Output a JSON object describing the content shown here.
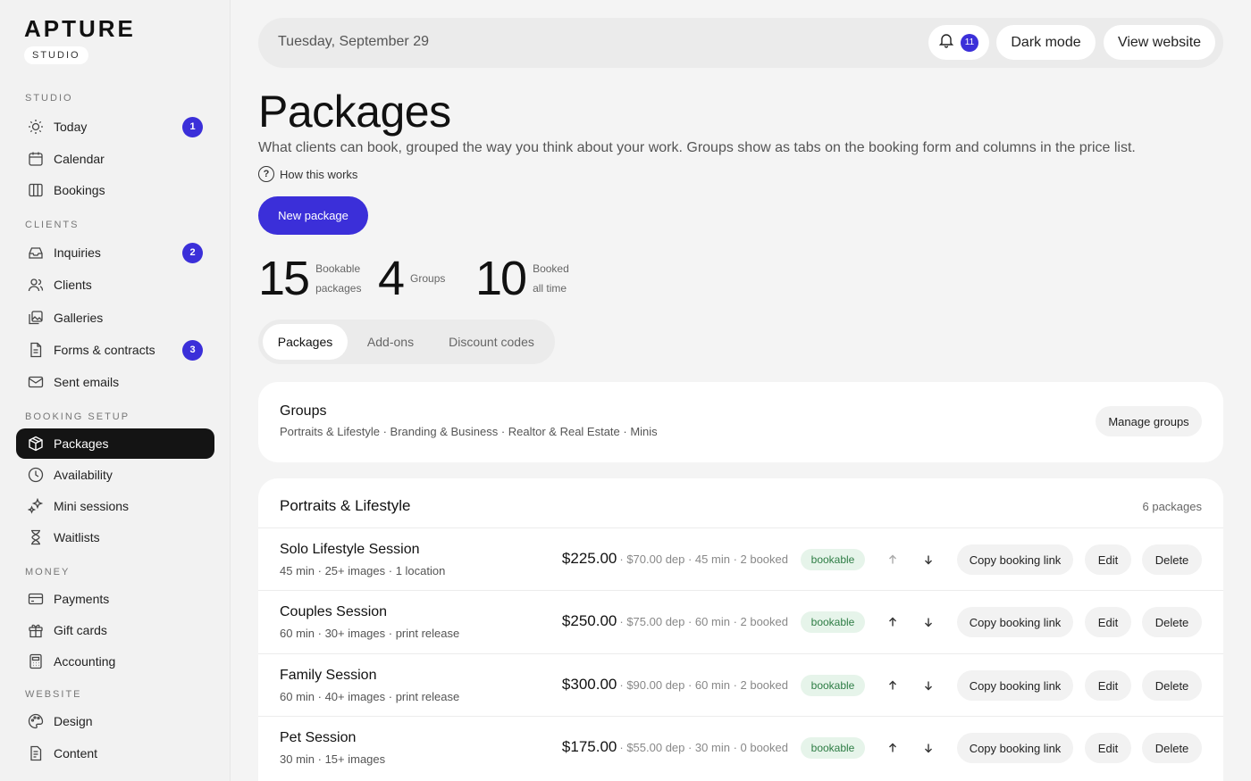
{
  "brand": {
    "name": "APTURE",
    "badge": "STUDIO"
  },
  "sidebar": {
    "sections": [
      {
        "label": "Studio",
        "items": [
          {
            "label": "Today",
            "icon": "sun-icon",
            "badge": "1"
          },
          {
            "label": "Calendar",
            "icon": "calendar-icon"
          },
          {
            "label": "Bookings",
            "icon": "columns-icon"
          }
        ]
      },
      {
        "label": "Clients",
        "items": [
          {
            "label": "Inquiries",
            "icon": "inbox-icon",
            "badge": "2"
          },
          {
            "label": "Clients",
            "icon": "users-icon"
          },
          {
            "label": "Galleries",
            "icon": "gallery-icon"
          },
          {
            "label": "Forms & contracts",
            "icon": "document-icon",
            "badge": "3"
          },
          {
            "label": "Sent emails",
            "icon": "mail-icon"
          }
        ]
      },
      {
        "label": "Booking setup",
        "items": [
          {
            "label": "Packages",
            "icon": "package-icon",
            "active": true
          },
          {
            "label": "Availability",
            "icon": "clock-icon"
          },
          {
            "label": "Mini sessions",
            "icon": "sparkle-icon"
          },
          {
            "label": "Waitlists",
            "icon": "hourglass-icon"
          }
        ]
      },
      {
        "label": "Money",
        "items": [
          {
            "label": "Payments",
            "icon": "card-icon"
          },
          {
            "label": "Gift cards",
            "icon": "gift-icon"
          },
          {
            "label": "Accounting",
            "icon": "calculator-icon"
          }
        ]
      },
      {
        "label": "Website",
        "items": [
          {
            "label": "Design",
            "icon": "palette-icon"
          },
          {
            "label": "Content",
            "icon": "page-icon"
          }
        ]
      }
    ]
  },
  "topbar": {
    "date": "Tuesday, September 29",
    "notification_count": "11",
    "dark_mode_label": "Dark mode",
    "view_website_label": "View website"
  },
  "header": {
    "title": "Packages",
    "subtitle": "What clients can book, grouped the way you think about your work. Groups show as tabs on the booking form and columns in the price list.",
    "how_label": "How this works",
    "new_button": "New package"
  },
  "stats": [
    {
      "value": "15",
      "label1": "Bookable",
      "label2": "packages"
    },
    {
      "value": "4",
      "label1": "Groups",
      "label2": ""
    },
    {
      "value": "10",
      "label1": "Booked",
      "label2": "all time"
    }
  ],
  "tabs": [
    {
      "label": "Packages",
      "active": true
    },
    {
      "label": "Add-ons"
    },
    {
      "label": "Discount codes"
    }
  ],
  "groups": {
    "title": "Groups",
    "list": "Portraits & Lifestyle · Branding & Business · Realtor & Real Estate · Minis",
    "manage_label": "Manage groups"
  },
  "package_list": {
    "title": "Portraits & Lifestyle",
    "count": "6 packages",
    "tag_label": "bookable",
    "copy_label": "Copy booking link",
    "edit_label": "Edit",
    "delete_label": "Delete",
    "rows": [
      {
        "name": "Solo Lifestyle Session",
        "meta": "45 min · 25+ images · 1 location",
        "price": "$225.00",
        "detail": "· $70.00 dep · 45 min · 2 booked"
      },
      {
        "name": "Couples Session",
        "meta": "60 min · 30+ images · print release",
        "price": "$250.00",
        "detail": "· $75.00 dep · 60 min · 2 booked"
      },
      {
        "name": "Family Session",
        "meta": "60 min · 40+ images · print release",
        "price": "$300.00",
        "detail": "· $90.00 dep · 60 min · 2 booked"
      },
      {
        "name": "Pet Session",
        "meta": "30 min · 15+ images",
        "price": "$175.00",
        "detail": "· $55.00 dep · 30 min · 0 booked"
      }
    ]
  }
}
